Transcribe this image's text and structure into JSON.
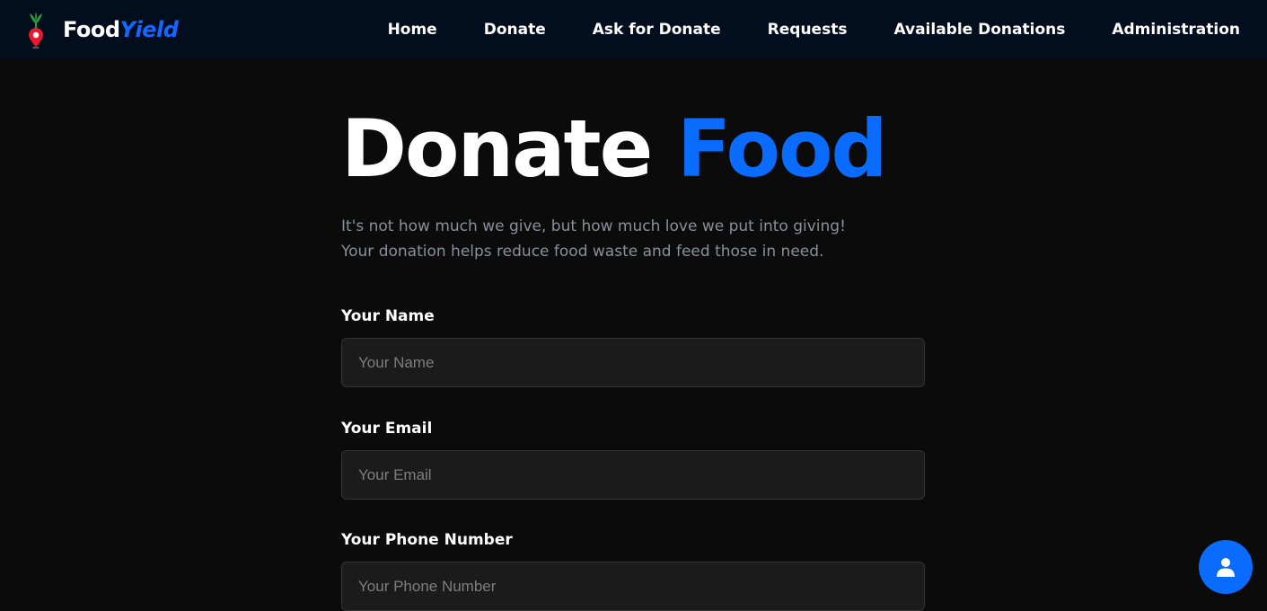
{
  "brand": {
    "name_part1": "Food",
    "name_part2": "Yield",
    "icon": "map-pin-plant-icon",
    "accent_color": "#1565ff"
  },
  "nav": {
    "items": [
      {
        "label": "Home"
      },
      {
        "label": "Donate"
      },
      {
        "label": "Ask for Donate"
      },
      {
        "label": "Requests"
      },
      {
        "label": "Available Donations"
      },
      {
        "label": "Administration"
      }
    ]
  },
  "hero": {
    "title_part1": "Donate",
    "title_part2": "Food",
    "subtitle_line1": "It's not how much we give, but how much love we put into giving!",
    "subtitle_line2": "Your donation helps reduce food waste and feed those in need."
  },
  "form": {
    "name": {
      "label": "Your Name",
      "placeholder": "Your Name",
      "value": ""
    },
    "email": {
      "label": "Your Email",
      "placeholder": "Your Email",
      "value": ""
    },
    "phone": {
      "label": "Your Phone Number",
      "placeholder": "Your Phone Number",
      "value": ""
    }
  },
  "fab": {
    "icon": "user-icon",
    "color": "#0a6bff"
  }
}
